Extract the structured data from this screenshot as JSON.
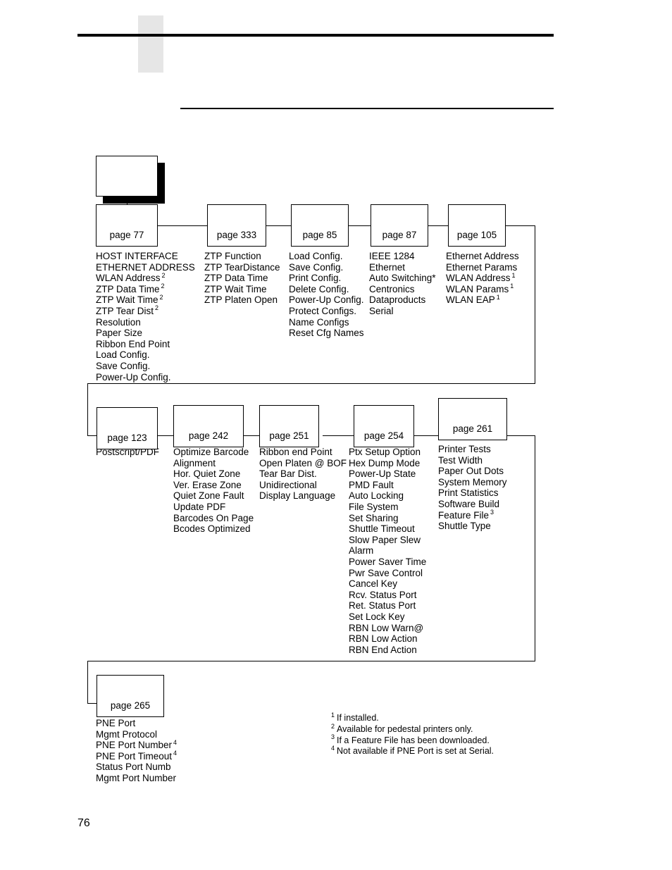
{
  "page": {
    "page_number": "76"
  },
  "diagram": {
    "root": {
      "label": ""
    },
    "rows": [
      {
        "columns": [
          {
            "box_label": "page 77",
            "items": [
              {
                "text": "HOST INTERFACE",
                "note": ""
              },
              {
                "text": "ETHERNET ADDRESS",
                "note": ""
              },
              {
                "text": "WLAN Address",
                "note": "2"
              },
              {
                "text": "ZTP Data Time",
                "note": "2"
              },
              {
                "text": "ZTP Wait Time",
                "note": "2"
              },
              {
                "text": "ZTP Tear Dist",
                "note": "2"
              },
              {
                "text": "Resolution",
                "note": ""
              },
              {
                "text": "Paper Size",
                "note": ""
              },
              {
                "text": "Ribbon End Point",
                "note": ""
              },
              {
                "text": "Load Config.",
                "note": ""
              },
              {
                "text": "Save Config.",
                "note": ""
              },
              {
                "text": "Power-Up Config.",
                "note": ""
              }
            ]
          },
          {
            "box_label": "page 333",
            "items": [
              {
                "text": "ZTP Function",
                "note": ""
              },
              {
                "text": "ZTP TearDistance",
                "note": ""
              },
              {
                "text": "ZTP Data Time",
                "note": ""
              },
              {
                "text": "ZTP Wait Time",
                "note": ""
              },
              {
                "text": "ZTP Platen Open",
                "note": ""
              }
            ]
          },
          {
            "box_label": "page 85",
            "items": [
              {
                "text": "Load Config.",
                "note": ""
              },
              {
                "text": "Save Config.",
                "note": ""
              },
              {
                "text": "Print Config.",
                "note": ""
              },
              {
                "text": "Delete Config.",
                "note": ""
              },
              {
                "text": "Power-Up Config.",
                "note": ""
              },
              {
                "text": "Protect Configs.",
                "note": ""
              },
              {
                "text": "Name Configs",
                "note": ""
              },
              {
                "text": "Reset Cfg Names",
                "note": ""
              }
            ]
          },
          {
            "box_label": "page 87",
            "items": [
              {
                "text": "IEEE 1284",
                "note": ""
              },
              {
                "text": "Ethernet",
                "note": ""
              },
              {
                "text": "Auto Switching*",
                "note": ""
              },
              {
                "text": "Centronics",
                "note": ""
              },
              {
                "text": "Dataproducts",
                "note": ""
              },
              {
                "text": "Serial",
                "note": ""
              }
            ]
          },
          {
            "box_label": "page 105",
            "items": [
              {
                "text": "Ethernet Address",
                "note": ""
              },
              {
                "text": "Ethernet Params",
                "note": ""
              },
              {
                "text": "WLAN Address",
                "note": "1"
              },
              {
                "text": "WLAN Params",
                "note": "1"
              },
              {
                "text": "WLAN EAP",
                "note": "1"
              }
            ]
          }
        ]
      },
      {
        "columns": [
          {
            "box_label": "page 123",
            "items": [
              {
                "text": "Postscript/PDF",
                "note": ""
              }
            ]
          },
          {
            "box_label": "page 242",
            "items": [
              {
                "text": "Optimize Barcode",
                "note": ""
              },
              {
                "text": "Alignment",
                "note": ""
              },
              {
                "text": "Hor. Quiet Zone",
                "note": ""
              },
              {
                "text": "Ver. Erase Zone",
                "note": ""
              },
              {
                "text": "Quiet Zone Fault",
                "note": ""
              },
              {
                "text": "Update PDF",
                "note": ""
              },
              {
                "text": "Barcodes On Page",
                "note": ""
              },
              {
                "text": "Bcodes Optimized",
                "note": ""
              }
            ]
          },
          {
            "box_label": "page 251",
            "items": [
              {
                "text": "Ribbon end Point",
                "note": ""
              },
              {
                "text": "Open Platen @ BOF",
                "note": ""
              },
              {
                "text": "Tear Bar Dist.",
                "note": ""
              },
              {
                "text": "Unidirectional",
                "note": ""
              },
              {
                "text": "Display Language",
                "note": ""
              }
            ]
          },
          {
            "box_label": "page 254",
            "items": [
              {
                "text": "Ptx Setup Option",
                "note": ""
              },
              {
                "text": "Hex Dump Mode",
                "note": ""
              },
              {
                "text": "Power-Up State",
                "note": ""
              },
              {
                "text": "PMD Fault",
                "note": ""
              },
              {
                "text": "Auto Locking",
                "note": ""
              },
              {
                "text": "File System",
                "note": ""
              },
              {
                "text": "Set Sharing",
                "note": ""
              },
              {
                "text": "Shuttle Timeout",
                "note": ""
              },
              {
                "text": "Slow Paper Slew",
                "note": ""
              },
              {
                "text": "Alarm",
                "note": ""
              },
              {
                "text": "Power Saver Time",
                "note": ""
              },
              {
                "text": "Pwr Save Control",
                "note": ""
              },
              {
                "text": "Cancel Key",
                "note": ""
              },
              {
                "text": "Rcv. Status Port",
                "note": ""
              },
              {
                "text": "Ret. Status Port",
                "note": ""
              },
              {
                "text": "Set Lock Key",
                "note": ""
              },
              {
                "text": "RBN Low Warn@",
                "note": ""
              },
              {
                "text": "RBN Low Action",
                "note": ""
              },
              {
                "text": "RBN End Action",
                "note": ""
              }
            ]
          },
          {
            "box_label": "page 261",
            "items": [
              {
                "text": "Printer Tests",
                "note": ""
              },
              {
                "text": "Test Width",
                "note": ""
              },
              {
                "text": "Paper Out Dots",
                "note": ""
              },
              {
                "text": "System Memory",
                "note": ""
              },
              {
                "text": "Print Statistics",
                "note": ""
              },
              {
                "text": "Software Build",
                "note": ""
              },
              {
                "text": "Feature File",
                "note": "3"
              },
              {
                "text": "Shuttle Type",
                "note": ""
              }
            ]
          }
        ]
      },
      {
        "columns": [
          {
            "box_label": "page 265",
            "items": [
              {
                "text": "PNE Port",
                "note": ""
              },
              {
                "text": "Mgmt Protocol",
                "note": ""
              },
              {
                "text": "PNE Port Number",
                "note": "4"
              },
              {
                "text": "PNE Port Timeout",
                "note": "4"
              },
              {
                "text": "Status Port Numb",
                "note": ""
              },
              {
                "text": "Mgmt Port Number",
                "note": ""
              }
            ]
          }
        ]
      }
    ]
  },
  "footnotes": [
    {
      "marker": "1",
      "text": "If installed."
    },
    {
      "marker": "2",
      "text": "Available for pedestal printers only."
    },
    {
      "marker": "3",
      "text": "If a Feature File has been downloaded."
    },
    {
      "marker": "4",
      "text": "Not available if PNE Port is set at Serial."
    }
  ]
}
